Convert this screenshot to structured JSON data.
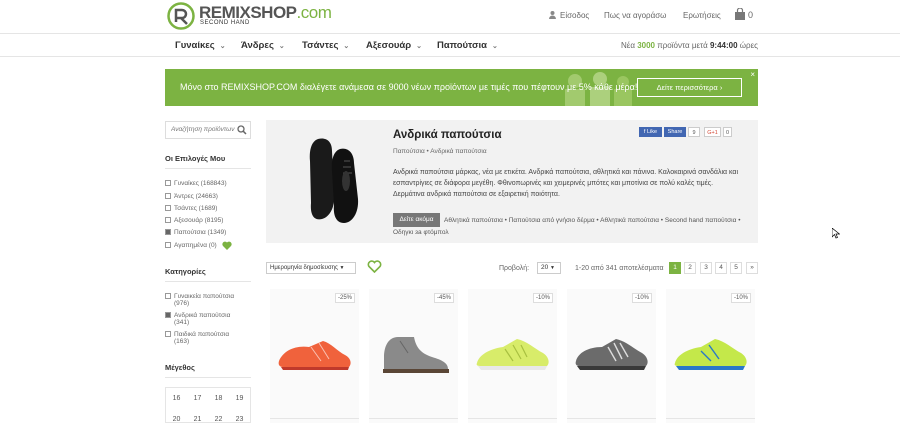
{
  "header": {
    "logo": {
      "brand": "REMIXSHOP",
      "tld": ".com",
      "sub": "SECOND HAND"
    },
    "links": {
      "login": "Είσοδος",
      "how": "Πως να αγοράσω",
      "faq": "Ερωτήσεις"
    },
    "cart_count": "0"
  },
  "nav": {
    "items": [
      "Γυναίκες",
      "Άνδρες",
      "Τσάντες",
      "Αξεσουάρ",
      "Παπούτσια"
    ],
    "caret": "⌄",
    "status": {
      "prefix": "Νέα",
      "count": "3000",
      "middle": "προϊόντα μετά",
      "time": "9:44:00",
      "suffix": "ώρες"
    }
  },
  "banner": {
    "text": "Μόνο στο REMIXSHOP.COM διαλέγετε ανάμεσα σε 9000 νέων προϊόντων με τιμές που πέφτουν με 5% κάθε μέρα!",
    "button": "Δείτε περισσότερα",
    "close": "×"
  },
  "sidebar": {
    "search_placeholder": "Αναζήτηση προϊόντων",
    "my_choices_title": "Οι Επιλογές Μου",
    "my_choices": [
      {
        "label": "Γυναίκες (168843)",
        "checked": false
      },
      {
        "label": "Άντρες (24663)",
        "checked": false
      },
      {
        "label": "Τσάντες (1689)",
        "checked": false
      },
      {
        "label": "Αξεσουάρ (8195)",
        "checked": false
      },
      {
        "label": "Παπούτσια (1349)",
        "checked": true
      },
      {
        "label": "Αγαπημένα (0)",
        "checked": false
      }
    ],
    "categories_title": "Κατηγορίες",
    "categories": [
      {
        "label": "Γυναικεία παπούτσια",
        "count": "(976)",
        "checked": false
      },
      {
        "label": "Ανδρικά παπούτσια",
        "count": "(341)",
        "checked": true
      },
      {
        "label": "Παιδικά παπούτσια",
        "count": "(163)",
        "checked": false
      }
    ],
    "size_title": "Μέγεθος",
    "sizes_row1": [
      "16",
      "17",
      "18",
      "19"
    ],
    "sizes_row2": [
      "20",
      "21",
      "22",
      "23"
    ]
  },
  "category": {
    "title": "Ανδρικά παπούτσια",
    "breadcrumb": "Παπούτσια  •  Ανδρικά παπούτσια",
    "description": "Ανδρικά παπούτσια μάρκας, νέα με ετικέτα. Ανδρικά παπούτσια, αθλητικά και πάνινα. Καλοκαιρινά σανδάλια και εσπαντρίγιες σε διάφορα μεγέθη. Φθινοπωρινές και χειμερινές μπότες και μποτίνια σε πολύ καλές τιμές. Δερμάτινα ανδρικά  παπούτσια σε εξαιρετική ποιότητα.",
    "more_button": "Δείτε ακόμα",
    "tags": "Αθλητικά παπούτσια  •  Παπούτσια από γνήσιο δέρμα  •  Αθλητικά παπούτσια  •  Second hand παπούτσια  •  Οδηγκι за φτόμπολ",
    "social": {
      "like": "Like",
      "share": "Share",
      "share_count": "9",
      "gplus": "G+1",
      "gplus_count": "0"
    }
  },
  "toolbar": {
    "sort": "Ημερομηνία δημοσίευσης",
    "view_label": "Προβολή:",
    "view_value": "20",
    "results": "1-20 από 341 αποτελέσματα",
    "pages": [
      "1",
      "2",
      "3",
      "4",
      "5",
      "»"
    ],
    "current_page": "1"
  },
  "products": [
    {
      "discount": "-25%",
      "color": "#f0623c"
    },
    {
      "discount": "-45%",
      "color": "#8a8a8a"
    },
    {
      "discount": "-10%",
      "color": "#d8ec6a"
    },
    {
      "discount": "-10%",
      "color": "#6b6b6b"
    },
    {
      "discount": "-10%",
      "color": "#c4e84a"
    }
  ],
  "colors": {
    "accent": "#7cb342"
  }
}
